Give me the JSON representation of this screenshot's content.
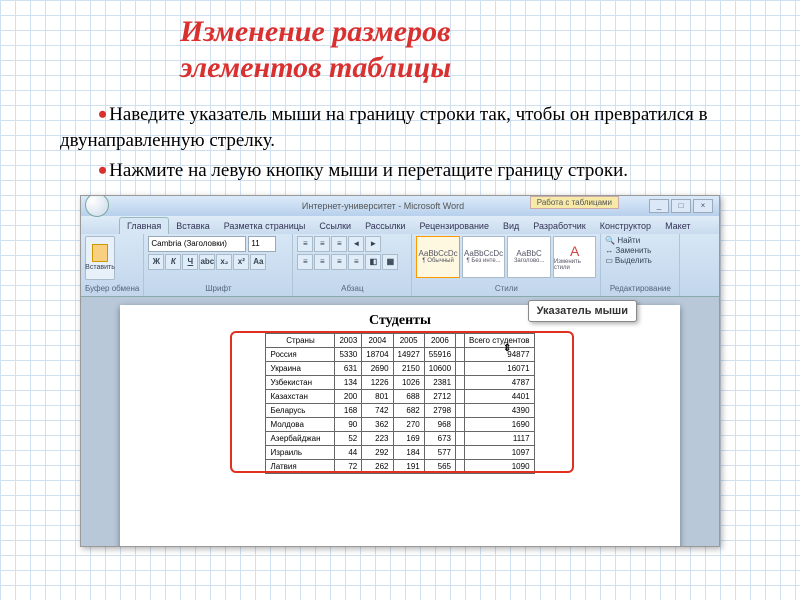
{
  "title_line1": "Изменение размеров",
  "title_line2": "элементов таблицы",
  "bullet1": "Наведите указатель мыши на границу строки так, чтобы он превратился в двунаправленную стрелку.",
  "bullet2": "Нажмите на левую кнопку мыши и перетащите границу строки.",
  "word": {
    "doc_title": "Интернет-университет - Microsoft Word",
    "tools_label": "Работа с таблицами",
    "tabs": [
      "Главная",
      "Вставка",
      "Разметка страницы",
      "Ссылки",
      "Рассылки",
      "Рецензирование",
      "Вид",
      "Разработчик",
      "Конструктор",
      "Макет"
    ],
    "active_tab": 0,
    "paste_label": "Вставить",
    "group_clipboard": "Буфер обмена",
    "font_name": "Cambria (Заголовки)",
    "font_size": "11",
    "group_font": "Шрифт",
    "group_para": "Абзац",
    "styles": [
      {
        "sample": "AaBbCcDc",
        "name": "¶ Обычный"
      },
      {
        "sample": "AaBbCcDc",
        "name": "¶ Без инте..."
      },
      {
        "sample": "AaBbC",
        "name": "Заголово..."
      }
    ],
    "change_styles": "Изменить стили",
    "group_styles": "Стили",
    "find": "Найти",
    "replace": "Заменить",
    "select": "Выделить",
    "group_edit": "Редактирование"
  },
  "callout": "Указатель мыши",
  "table": {
    "title": "Студенты",
    "headers": [
      "Страны",
      "2003",
      "2004",
      "2005",
      "2006",
      "",
      "Всего студентов"
    ],
    "rows": [
      [
        "Россия",
        "5330",
        "18704",
        "14927",
        "55916",
        "",
        "94877"
      ],
      [
        "Украина",
        "631",
        "2690",
        "2150",
        "10600",
        "",
        "16071"
      ],
      [
        "Узбекистан",
        "134",
        "1226",
        "1026",
        "2381",
        "",
        "4787"
      ],
      [
        "Казахстан",
        "200",
        "801",
        "688",
        "2712",
        "",
        "4401"
      ],
      [
        "Беларусь",
        "168",
        "742",
        "682",
        "2798",
        "",
        "4390"
      ],
      [
        "Молдова",
        "90",
        "362",
        "270",
        "968",
        "",
        "1690"
      ],
      [
        "Азербайджан",
        "52",
        "223",
        "169",
        "673",
        "",
        "1117"
      ],
      [
        "Израиль",
        "44",
        "292",
        "184",
        "577",
        "",
        "1097"
      ],
      [
        "Латвия",
        "72",
        "262",
        "191",
        "565",
        "",
        "1090"
      ]
    ]
  }
}
